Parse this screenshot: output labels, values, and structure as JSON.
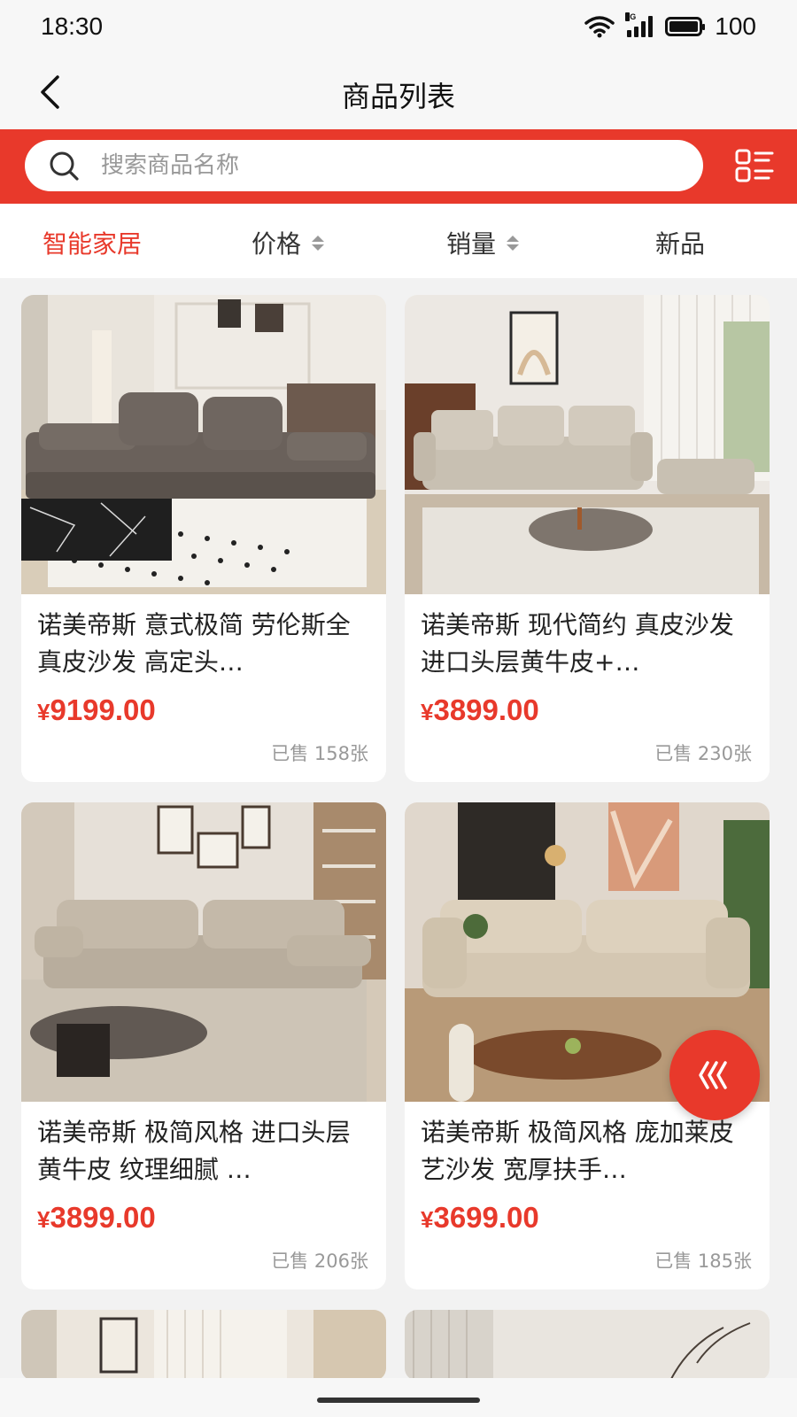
{
  "status_bar": {
    "time": "18:30",
    "battery": "100",
    "network_label": "5G",
    "icons": [
      "wifi-icon",
      "signal-icon",
      "battery-icon"
    ]
  },
  "nav": {
    "title": "商品列表",
    "back_icon": "chevron-left-icon"
  },
  "search": {
    "placeholder": "搜索商品名称",
    "value": "",
    "icon": "search-icon",
    "layout_toggle_icon": "list-layout-icon"
  },
  "filters": [
    {
      "label": "智能家居",
      "active": true,
      "sortable": false
    },
    {
      "label": "价格",
      "active": false,
      "sortable": true
    },
    {
      "label": "销量",
      "active": false,
      "sortable": true
    },
    {
      "label": "新品",
      "active": false,
      "sortable": false
    }
  ],
  "products": [
    {
      "title": "诺美帝斯 意式极简 劳伦斯全真皮沙发 高定头…",
      "currency": "¥",
      "price": "9199.00",
      "sold": "已售 158张"
    },
    {
      "title": "诺美帝斯 现代简约 真皮沙发 进口头层黄牛皮+…",
      "currency": "¥",
      "price": "3899.00",
      "sold": "已售 230张"
    },
    {
      "title": "诺美帝斯 极简风格 进口头层黄牛皮 纹理细腻 …",
      "currency": "¥",
      "price": "3899.00",
      "sold": "已售 206张"
    },
    {
      "title": "诺美帝斯 极简风格 庞加莱皮艺沙发 宽厚扶手…",
      "currency": "¥",
      "price": "3699.00",
      "sold": "已售 185张"
    }
  ],
  "floating_button": {
    "icon": "triple-chevron-left-icon"
  },
  "colors": {
    "accent": "#e8392b",
    "background": "#f2f2f2",
    "card": "#ffffff",
    "muted_text": "#999999"
  }
}
